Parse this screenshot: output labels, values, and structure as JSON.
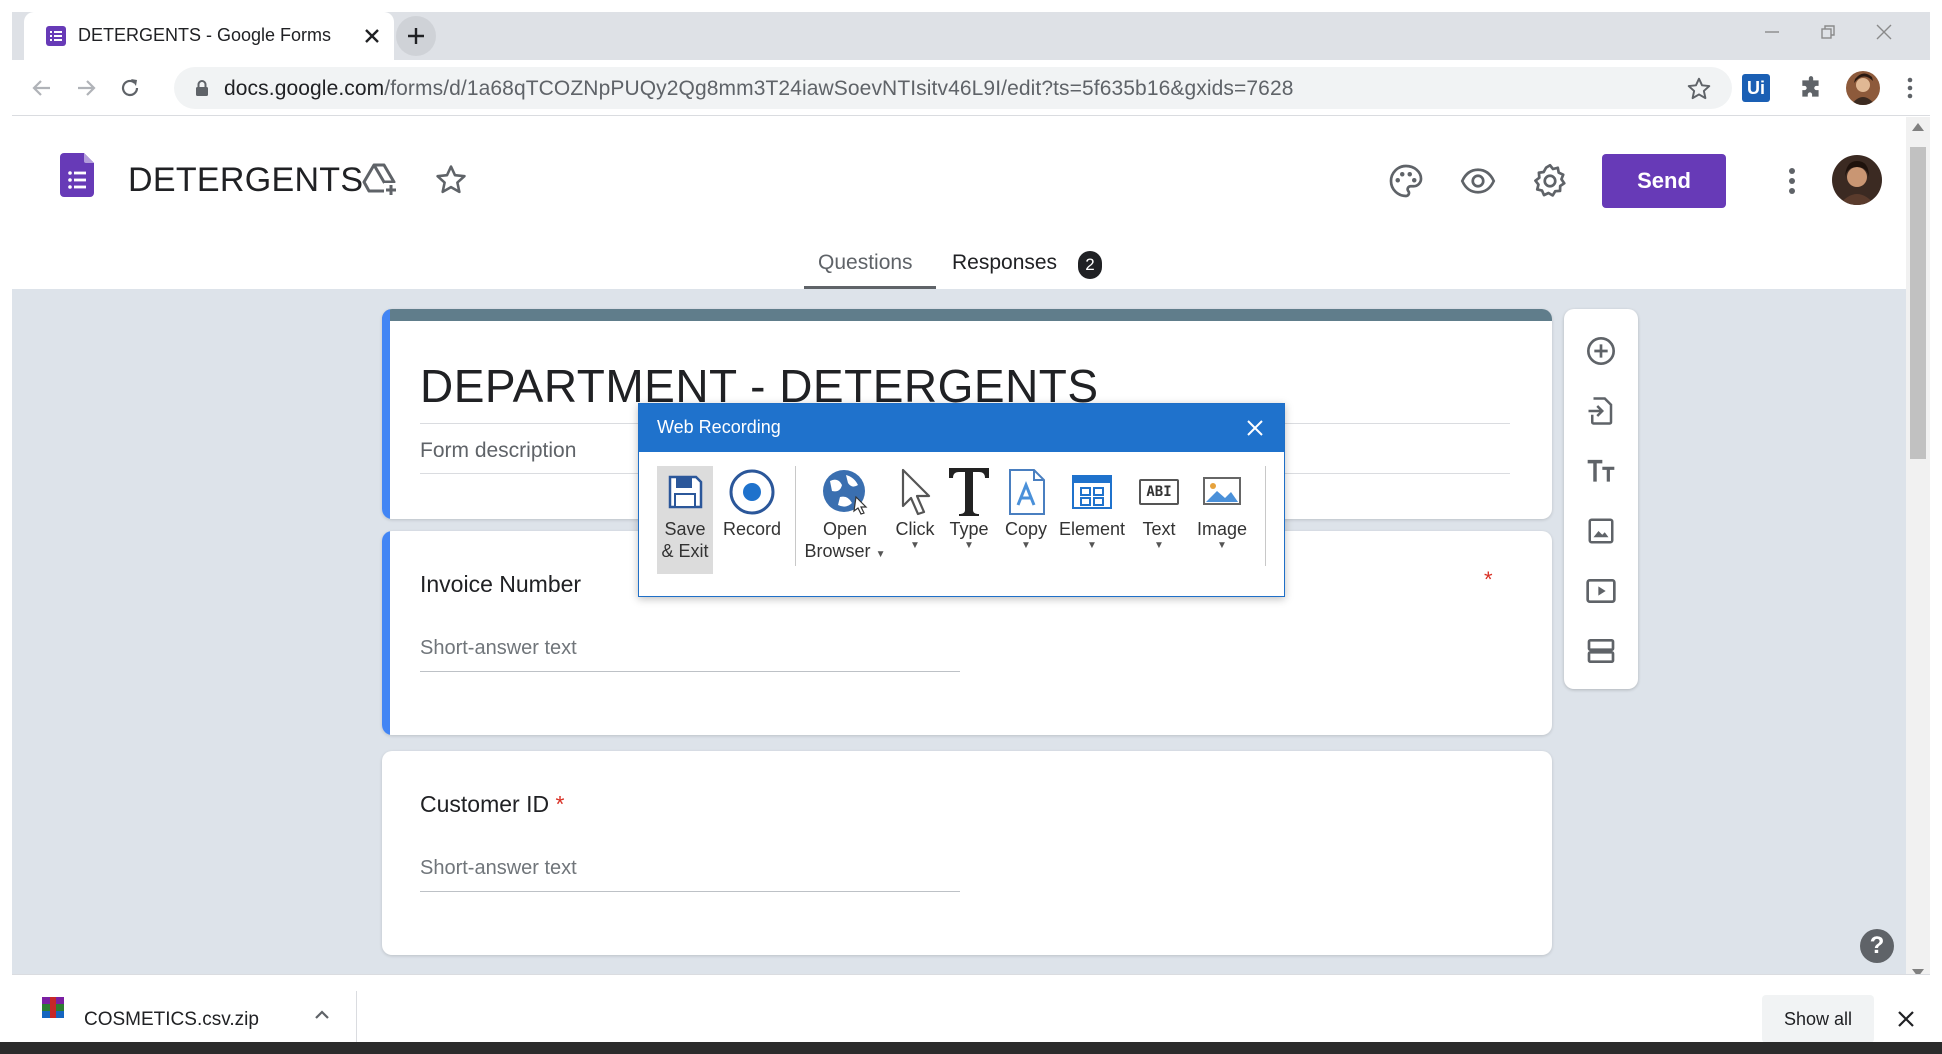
{
  "browser": {
    "tab_title": "DETERGENTS - Google Forms",
    "url_host": "docs.google.com",
    "url_path": "/forms/d/1a68qTCOZNpPUQy2Qg8mm3T24iawSoevNTIsitv46L9I/edit?ts=5f635b16&gxids=7628",
    "extension_label": "Ui"
  },
  "header": {
    "doc_title": "DETERGENTS",
    "send_label": "Send",
    "tabs": [
      {
        "label": "Questions",
        "active": true
      },
      {
        "label": "Responses",
        "badge": "2"
      }
    ]
  },
  "form": {
    "title": "DEPARTMENT - DETERGENTS",
    "description_placeholder": "Form description",
    "questions": [
      {
        "label": "Invoice Number",
        "required_mark": "*",
        "placeholder": "Short-answer text"
      },
      {
        "label": "Customer ID",
        "required_mark": "*",
        "placeholder": "Short-answer text"
      }
    ]
  },
  "help_label": "?",
  "recording_dialog": {
    "title": "Web Recording",
    "buttons": [
      {
        "label_line1": "Save",
        "label_line2": "& Exit",
        "icon": "save-icon"
      },
      {
        "label_line1": "Record",
        "label_line2": "",
        "icon": "record-icon"
      },
      {
        "label_line1": "Open",
        "label_line2": "Browser",
        "icon": "globe-icon",
        "dropdown": true
      },
      {
        "label_line1": "Click",
        "label_line2": "",
        "icon": "cursor-icon",
        "dropdown": true
      },
      {
        "label_line1": "Type",
        "label_line2": "",
        "icon": "type-icon",
        "dropdown": true
      },
      {
        "label_line1": "Copy",
        "label_line2": "",
        "icon": "copy-icon",
        "dropdown": true
      },
      {
        "label_line1": "Element",
        "label_line2": "",
        "icon": "element-icon",
        "dropdown": true
      },
      {
        "label_line1": "Text",
        "label_line2": "",
        "icon": "text-icon",
        "dropdown": true,
        "icon_text": "ABI"
      },
      {
        "label_line1": "Image",
        "label_line2": "",
        "icon": "image-icon",
        "dropdown": true
      }
    ]
  },
  "download_bar": {
    "file_name": "COSMETICS.csv.zip",
    "show_all_label": "Show all"
  },
  "colors": {
    "forms_purple": "#673ab7",
    "accent_blue": "#4285f4",
    "header_band": "#607d8b",
    "required_red": "#d93025",
    "recording_blue": "#1f72cc"
  }
}
